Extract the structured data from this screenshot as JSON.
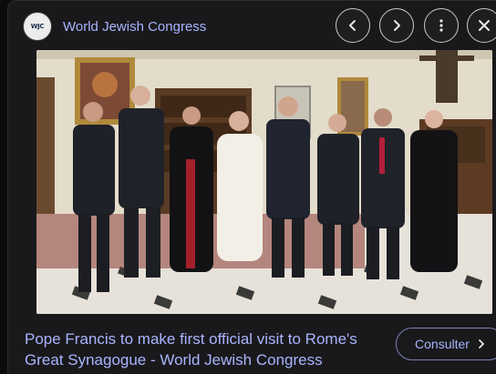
{
  "source": {
    "favicon_text": "WJC",
    "name": "World Jewish Congress"
  },
  "controls": {
    "prev": "chevron-left-icon",
    "next": "chevron-right-icon",
    "more": "more-vert-icon",
    "close": "close-icon"
  },
  "image": {
    "lens": "lens-icon"
  },
  "result": {
    "title_line1": "Pope Francis to make first official visit to Rome's",
    "title_line2": "Great Synagogue - World Jewish Congress",
    "visit_label": "Consulter"
  },
  "colors": {
    "link": "#a8b4ff",
    "panel": "#19191b",
    "background": "#0c0c0d"
  }
}
